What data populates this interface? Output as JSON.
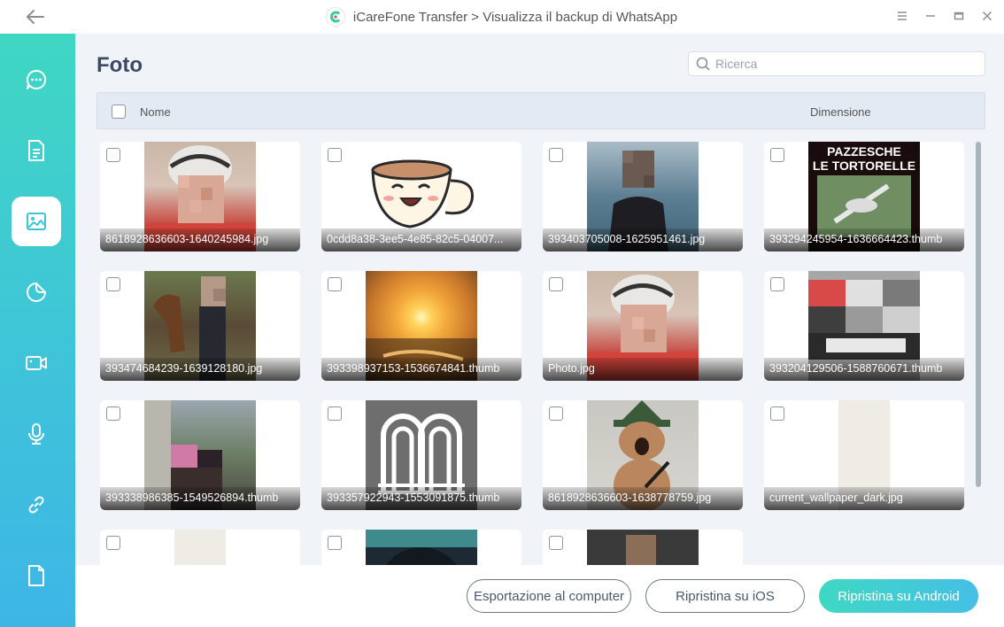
{
  "window": {
    "title": "iCareFone Transfer > Visualizza il backup di WhatsApp"
  },
  "page": {
    "title": "Foto"
  },
  "search": {
    "placeholder": "Ricerca"
  },
  "table": {
    "col_name": "Nome",
    "col_size": "Dimensione"
  },
  "icons": {
    "back": "arrow-left-icon",
    "menu": "hamburger-icon",
    "minimize": "minimize-icon",
    "maximize": "maximize-icon",
    "close": "close-icon",
    "search": "search-icon"
  },
  "sidebar": {
    "items": [
      {
        "icon": "chat-icon",
        "active": false
      },
      {
        "icon": "document-icon",
        "active": false
      },
      {
        "icon": "image-icon",
        "active": true
      },
      {
        "icon": "sticker-icon",
        "active": false
      },
      {
        "icon": "video-icon",
        "active": false
      },
      {
        "icon": "microphone-icon",
        "active": false
      },
      {
        "icon": "link-icon",
        "active": false
      },
      {
        "icon": "file-icon",
        "active": false
      }
    ]
  },
  "photos": [
    {
      "name": "8618928636603-1640245984.jpg"
    },
    {
      "name": "0cdd8a38-3ee5-4e85-82c5-04007..."
    },
    {
      "name": "393403705008-1625951461.jpg"
    },
    {
      "name": "393294245954-1636664423.thumb"
    },
    {
      "name": "393474684239-1639128180.jpg"
    },
    {
      "name": "393398937153-1536674841.thumb"
    },
    {
      "name": "Photo.jpg"
    },
    {
      "name": "393204129506-1588760671.thumb"
    },
    {
      "name": "393338986385-1549526894.thumb"
    },
    {
      "name": "393357922943-1553091875.thumb"
    },
    {
      "name": "8618928636603-1638778759.jpg"
    },
    {
      "name": "current_wallpaper_dark.jpg"
    },
    {
      "name": ""
    },
    {
      "name": ""
    },
    {
      "name": ""
    }
  ],
  "poster_text": {
    "line1": "PAZZESCHE",
    "line2": "LE TORTORELLE"
  },
  "buttons": {
    "export": "Esportazione al computer",
    "restore_ios": "Ripristina su iOS",
    "restore_android": "Ripristina su Android"
  },
  "colors": {
    "accent": "#3fd7c3",
    "sidebar_end": "#3db6e6",
    "title": "#3b4a62"
  }
}
